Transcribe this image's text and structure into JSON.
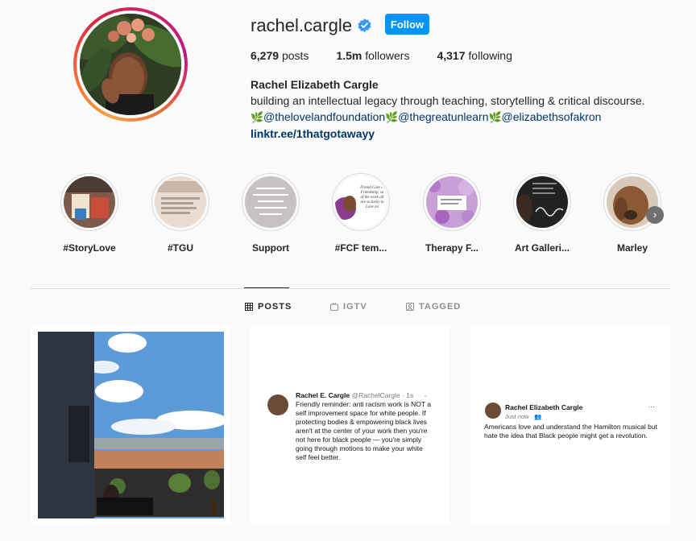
{
  "profile": {
    "username": "rachel.cargle",
    "follow_label": "Follow",
    "stats": {
      "posts": "6,279",
      "posts_label": "posts",
      "followers": "1.5m",
      "followers_label": "followers",
      "following": "4,317",
      "following_label": "following"
    },
    "full_name": "Rachel Elizabeth Cargle",
    "bio_line": "building an intellectual legacy through teaching, storytelling & critical discourse.",
    "mentions": [
      "@thelovelandfoundation",
      "@thegreatunlearn",
      "@elizabethsofakron"
    ],
    "link": "linktr.ee/1thatgotawayy"
  },
  "highlights": [
    {
      "label": "#StoryLove"
    },
    {
      "label": "#TGU"
    },
    {
      "label": "Support"
    },
    {
      "label": "#FCF tem..."
    },
    {
      "label": "Therapy F..."
    },
    {
      "label": "Art Galleri..."
    },
    {
      "label": "Marley"
    }
  ],
  "highlight_fcf_text": "Friend Care of Friendship, so of the work all are so lucky to Love on",
  "tabs": [
    {
      "label": "POSTS",
      "active": true
    },
    {
      "label": "IGTV",
      "active": false
    },
    {
      "label": "TAGGED",
      "active": false
    }
  ],
  "posts": {
    "tweet1": {
      "name": "Rachel E. Cargle",
      "handle": "@RachelCargle · 1s",
      "body": "Friendly reminder: anti racism work is NOT a self improvement space for white people. If protecting bodies & empowering black lives aren't at the center of your work then you're not here for black people — you're simply going through motions to make your white self feel better."
    },
    "tweet2": {
      "name": "Rachel Elizabeth Cargle",
      "meta": "Just now · ",
      "more": "···",
      "body": "Americans love  and understand the Hamilton musical but hate the idea that Black people might get a revolution."
    }
  },
  "colors": {
    "accent": "#0095f6",
    "link": "#00376b",
    "text": "#262626",
    "muted": "#8e8e8e"
  }
}
